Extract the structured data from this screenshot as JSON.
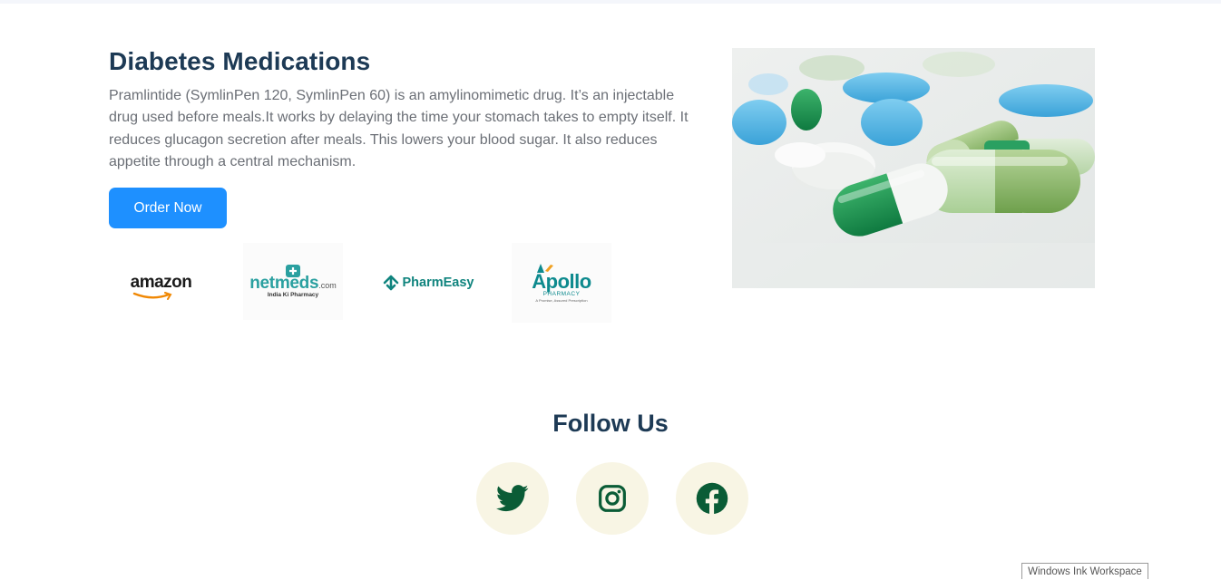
{
  "product": {
    "title": "Diabetes Medications",
    "description": "Pramlintide (SymlinPen 120, SymlinPen 60) is an amylinomimetic drug. It’s an injectable drug used before meals.It works by delaying the time your stomach takes to empty itself. It reduces glucagon secretion after meals. This lowers your blood sugar. It also reduces appetite through a central mechanism.",
    "order_button": "Order Now",
    "image_icon": "pills-capsules-photo"
  },
  "pharmacies": {
    "amazon": "amazon",
    "netmeds": "netmeds",
    "netmeds_com": ".com",
    "netmeds_tagline": "India Ki Pharmacy",
    "pharmeasy": "PharmEasy",
    "apollo": "Apollo",
    "apollo_sub": "PHARMACY",
    "apollo_tagline": "A Promise, Assured Prescription"
  },
  "follow": {
    "title": "Follow Us",
    "icons": [
      "twitter-icon",
      "instagram-icon",
      "facebook-icon"
    ]
  },
  "overlay": {
    "ink_workspace": "Windows Ink Workspace"
  },
  "colors": {
    "heading": "#1d3a55",
    "button": "#1e90ff",
    "social_bg": "#f8f5e4",
    "social_icon": "#0a5c36"
  }
}
